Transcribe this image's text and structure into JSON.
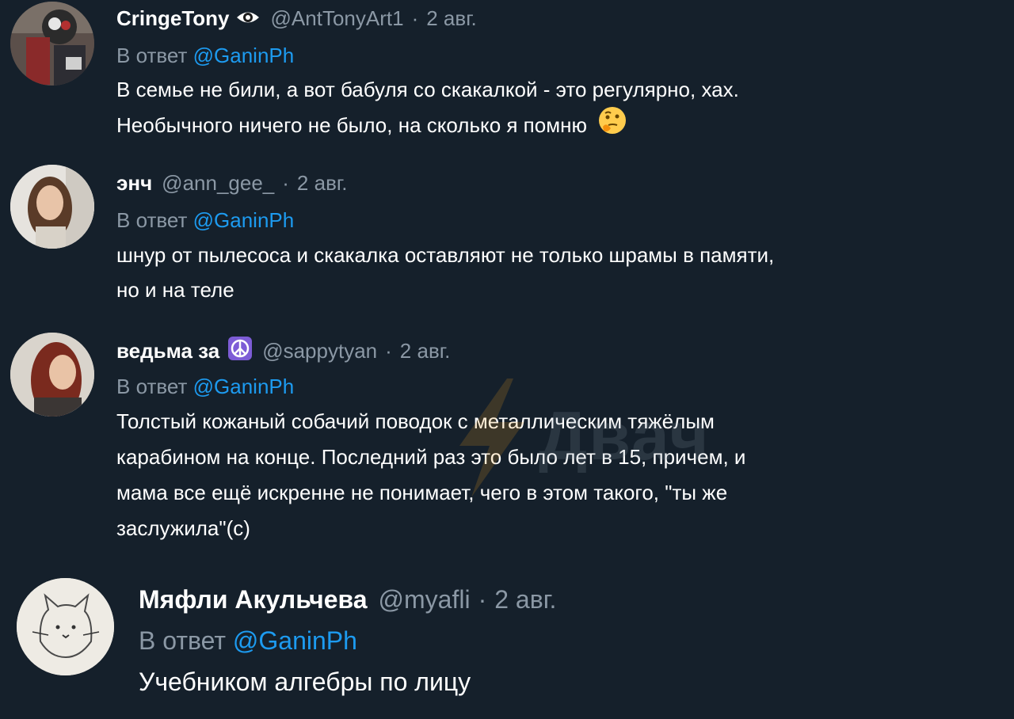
{
  "tweets": [
    {
      "name": "CringeTony",
      "badge_icon": "eye-icon",
      "handle": "@AntTonyArt1",
      "separator": "·",
      "date": "2 авг.",
      "reply_prefix": "В ответ",
      "reply_to": "@GaninPh",
      "lines": [
        "В семье не били, а вот бабуля со скакалкой - это регулярно, хах.",
        "Необычного ничего не было, на сколько я помню"
      ],
      "emoji_icon": "thinking-face-icon"
    },
    {
      "name": "энч",
      "handle": "@ann_gee_",
      "separator": "·",
      "date": "2 авг.",
      "reply_prefix": "В ответ",
      "reply_to": "@GaninPh",
      "lines": [
        "шнур от пылесоса и скакалка оставляют не только шрамы в памяти,",
        "но и на теле"
      ]
    },
    {
      "name": "ведьма за",
      "badge_icon": "peace-symbol-icon",
      "handle": "@sappytyan",
      "separator": "·",
      "date": "2 авг.",
      "reply_prefix": "В ответ",
      "reply_to": "@GaninPh",
      "lines": [
        "Толстый кожаный собачий поводок с металлическим тяжёлым",
        "карабином на конце. Последний раз это было лет в 15, причем, и",
        "мама все ещё искренне не понимает, чего в этом такого, \"ты же",
        "заслужила\"(с)"
      ]
    },
    {
      "name": "Мяфли Акульчева",
      "handle": "@myafli",
      "separator": "·",
      "date": "2 авг.",
      "reply_prefix": "В ответ",
      "reply_to": "@GaninPh",
      "lines": [
        "Учебником алгебры по лицу"
      ]
    }
  ],
  "watermark": {
    "text": "Двач",
    "icon": "lightning-bolt-icon"
  },
  "colors": {
    "background": "#15202b",
    "text": "#ffffff",
    "muted": "#8b98a5",
    "mention": "#1d9bf0"
  }
}
